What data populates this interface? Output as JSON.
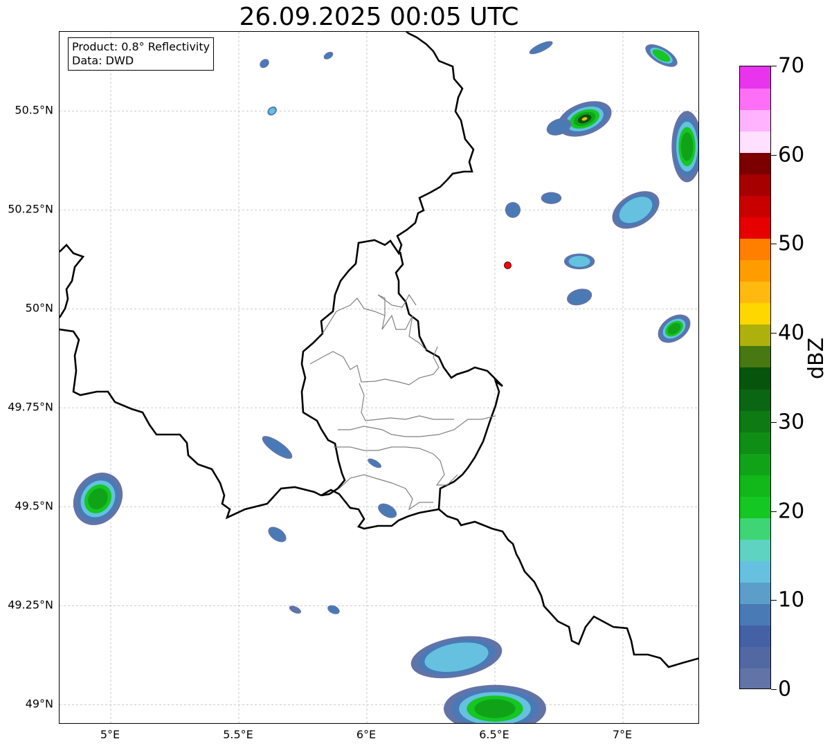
{
  "title": "26.09.2025 00:05 UTC",
  "info": {
    "line1": "Product: 0.8° Reflectivity",
    "line2": "Data: DWD"
  },
  "map": {
    "lon_range": [
      4.8,
      7.3
    ],
    "lat_range": [
      48.95,
      50.7
    ],
    "lat_ticks": [
      {
        "value": 50.5,
        "label": "50.5°N"
      },
      {
        "value": 50.25,
        "label": "50.25°N"
      },
      {
        "value": 50.0,
        "label": "50°N"
      },
      {
        "value": 49.75,
        "label": "49.75°N"
      },
      {
        "value": 49.5,
        "label": "49.5°N"
      },
      {
        "value": 49.25,
        "label": "49.25°N"
      },
      {
        "value": 49.0,
        "label": "49°N"
      }
    ],
    "lon_ticks": [
      {
        "value": 5.0,
        "label": "5°E"
      },
      {
        "value": 5.5,
        "label": "5.5°E"
      },
      {
        "value": 6.0,
        "label": "6°E"
      },
      {
        "value": 6.5,
        "label": "6.5°E"
      },
      {
        "value": 7.0,
        "label": "7°E"
      }
    ],
    "radar_site": {
      "lon": 6.55,
      "lat": 50.11,
      "color": "#ff0000"
    },
    "echoes": [
      {
        "lon": 6.85,
        "lat": 50.48,
        "rx": 0.11,
        "ry": 0.04,
        "max_dbz": 45,
        "angle": -20
      },
      {
        "lon": 6.75,
        "lat": 50.46,
        "rx": 0.05,
        "ry": 0.02,
        "max_dbz": 12,
        "angle": -20
      },
      {
        "lon": 7.15,
        "lat": 50.64,
        "rx": 0.07,
        "ry": 0.02,
        "max_dbz": 20,
        "angle": 30
      },
      {
        "lon": 7.25,
        "lat": 50.41,
        "rx": 0.06,
        "ry": 0.09,
        "max_dbz": 25,
        "angle": 0
      },
      {
        "lon": 7.05,
        "lat": 50.25,
        "rx": 0.1,
        "ry": 0.04,
        "max_dbz": 18,
        "angle": -30
      },
      {
        "lon": 6.83,
        "lat": 50.12,
        "rx": 0.06,
        "ry": 0.02,
        "max_dbz": 18,
        "angle": 0
      },
      {
        "lon": 6.83,
        "lat": 50.03,
        "rx": 0.05,
        "ry": 0.02,
        "max_dbz": 10,
        "angle": -15
      },
      {
        "lon": 6.72,
        "lat": 50.28,
        "rx": 0.04,
        "ry": 0.015,
        "max_dbz": 8,
        "angle": 0
      },
      {
        "lon": 6.57,
        "lat": 50.25,
        "rx": 0.03,
        "ry": 0.02,
        "max_dbz": 8,
        "angle": 0
      },
      {
        "lon": 7.2,
        "lat": 49.95,
        "rx": 0.07,
        "ry": 0.03,
        "max_dbz": 25,
        "angle": -35
      },
      {
        "lon": 4.95,
        "lat": 49.52,
        "rx": 0.09,
        "ry": 0.07,
        "max_dbz": 25,
        "angle": 35
      },
      {
        "lon": 5.65,
        "lat": 49.65,
        "rx": 0.07,
        "ry": 0.015,
        "max_dbz": 12,
        "angle": 35
      },
      {
        "lon": 5.65,
        "lat": 49.43,
        "rx": 0.04,
        "ry": 0.015,
        "max_dbz": 10,
        "angle": 35
      },
      {
        "lon": 6.08,
        "lat": 49.49,
        "rx": 0.04,
        "ry": 0.015,
        "max_dbz": 10,
        "angle": 30
      },
      {
        "lon": 6.35,
        "lat": 49.12,
        "rx": 0.18,
        "ry": 0.05,
        "max_dbz": 18,
        "angle": -10
      },
      {
        "lon": 6.5,
        "lat": 48.99,
        "rx": 0.2,
        "ry": 0.06,
        "max_dbz": 25,
        "angle": 0
      },
      {
        "lon": 5.87,
        "lat": 49.24,
        "rx": 0.025,
        "ry": 0.01,
        "max_dbz": 8,
        "angle": 25
      },
      {
        "lon": 5.72,
        "lat": 49.24,
        "rx": 0.025,
        "ry": 0.008,
        "max_dbz": 6,
        "angle": 25
      },
      {
        "lon": 5.6,
        "lat": 50.62,
        "rx": 0.02,
        "ry": 0.01,
        "max_dbz": 12,
        "angle": -40
      },
      {
        "lon": 5.85,
        "lat": 50.64,
        "rx": 0.02,
        "ry": 0.008,
        "max_dbz": 12,
        "angle": -30
      },
      {
        "lon": 5.63,
        "lat": 50.5,
        "rx": 0.02,
        "ry": 0.01,
        "max_dbz": 14,
        "angle": -40
      },
      {
        "lon": 6.68,
        "lat": 50.66,
        "rx": 0.05,
        "ry": 0.01,
        "max_dbz": 12,
        "angle": -25
      },
      {
        "lon": 6.03,
        "lat": 49.61,
        "rx": 0.03,
        "ry": 0.008,
        "max_dbz": 10,
        "angle": 30
      }
    ]
  },
  "colorbar": {
    "title": "dBZ",
    "min": 0,
    "max": 70,
    "ticks": [
      0,
      10,
      20,
      30,
      40,
      50,
      60,
      70
    ],
    "tick_labels": [
      "0",
      "10",
      "20",
      "30",
      "40",
      "50",
      "60",
      "70"
    ],
    "colors": [
      "#6273a8",
      "#5168a3",
      "#4461a6",
      "#4a7ab5",
      "#5b9ec9",
      "#65c1df",
      "#5ed3c2",
      "#3ed675",
      "#14c722",
      "#12b819",
      "#10a318",
      "#0f8e15",
      "#0d7a13",
      "#0a6612",
      "#07540c",
      "#477812",
      "#aeb00c",
      "#ffd700",
      "#ffb90f",
      "#ff9c00",
      "#ff7f00",
      "#e60000",
      "#c80000",
      "#a60000",
      "#7c0000",
      "#ffe0ff",
      "#ffb3ff",
      "#ff6ef7",
      "#e934ee"
    ]
  }
}
